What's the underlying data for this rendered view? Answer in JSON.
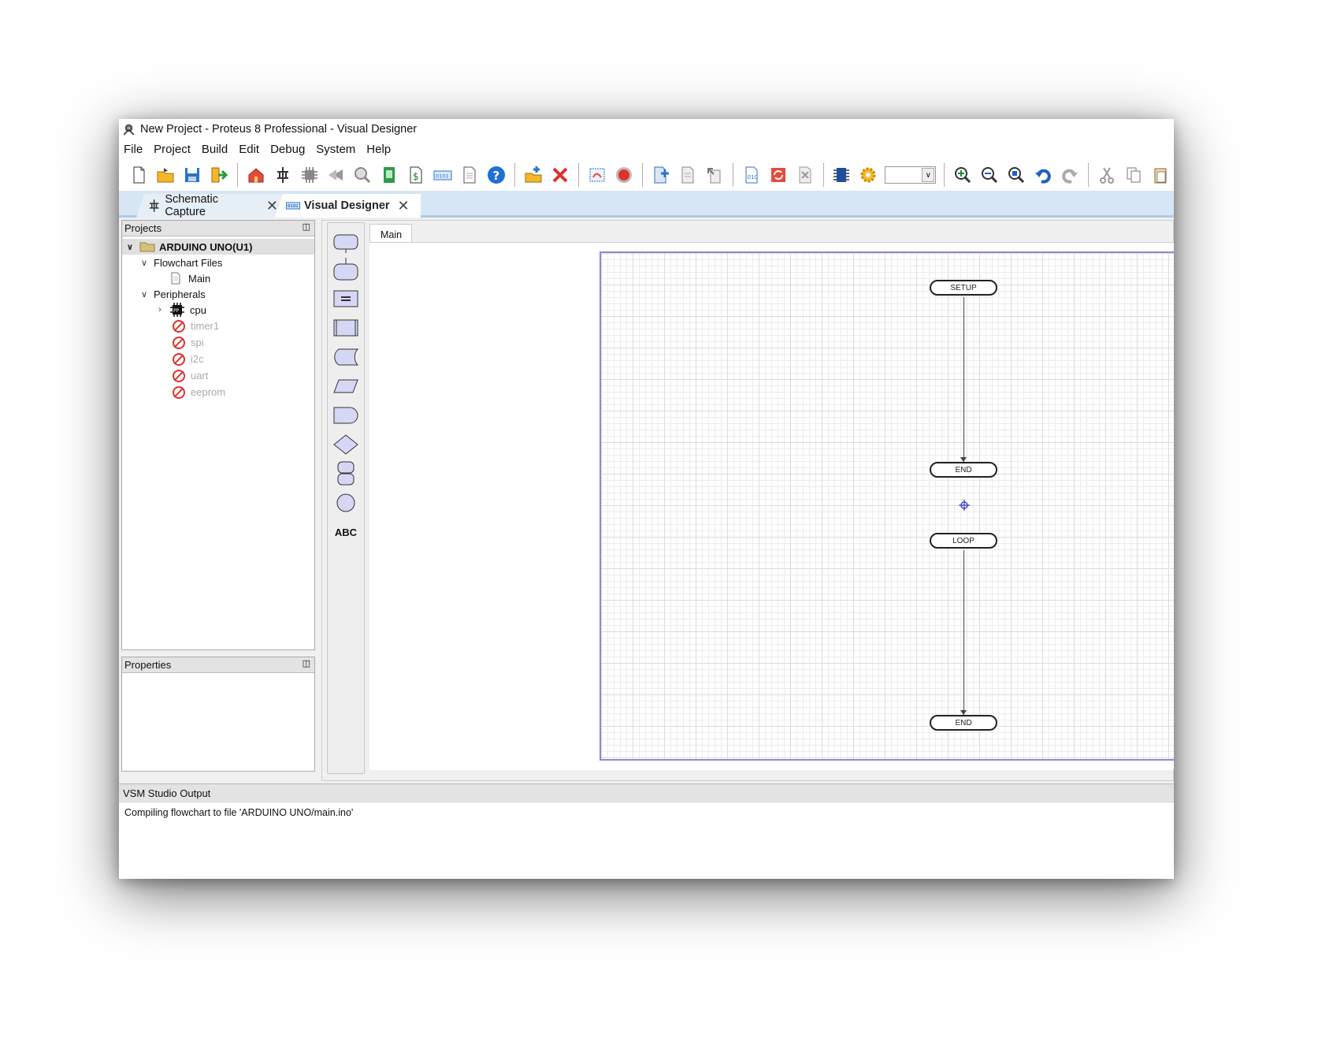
{
  "window": {
    "title": "New Project - Proteus 8 Professional - Visual Designer"
  },
  "menu": [
    "File",
    "Project",
    "Build",
    "Edit",
    "Debug",
    "System",
    "Help"
  ],
  "toolbar_icons": [
    "new-file-icon",
    "open-folder-icon",
    "save-icon",
    "import-icon",
    "home-icon",
    "schematic-icon",
    "chip-icon",
    "gerber-icon",
    "3d-viewer-icon",
    "bom-icon",
    "design-explorer-icon",
    "source-code-icon",
    "notes-icon",
    "help-icon",
    "add-peripheral-icon",
    "delete-icon",
    "edit-flowchart-icon",
    "stop-icon",
    "new-sheet-icon",
    "page-icon",
    "export-icon",
    "build-project-icon",
    "refresh-icon",
    "tools-icon",
    "cpu-icon",
    "settings-icon",
    "zoom-in-icon",
    "zoom-out-icon",
    "zoom-fit-icon",
    "undo-icon",
    "redo-icon",
    "cut-icon",
    "copy-icon",
    "paste-icon"
  ],
  "tabs": {
    "schematic": "Schematic Capture",
    "visual": "Visual Designer"
  },
  "projects": {
    "header": "Projects",
    "root": "ARDUINO UNO(U1)",
    "flowchart_files": "Flowchart Files",
    "main": "Main",
    "peripherals": "Peripherals",
    "cpu": "cpu",
    "disabled": [
      "timer1",
      "spi",
      "i2c",
      "uart",
      "eeprom"
    ]
  },
  "properties": {
    "header": "Properties"
  },
  "shapes": {
    "text_tool": "ABC"
  },
  "document": {
    "tab": "Main"
  },
  "flowchart": {
    "setup": "SETUP",
    "end1": "END",
    "loop": "LOOP",
    "end2": "END"
  },
  "output": {
    "header": "VSM Studio Output",
    "line": "Compiling flowchart to file 'ARDUINO UNO/main.ino'"
  },
  "colors": {
    "tab_bar": "#d7e6f5",
    "sheet_border": "#8b8bd8",
    "shape_fill": "#d6d7f5",
    "error_red": "#e0302b"
  }
}
